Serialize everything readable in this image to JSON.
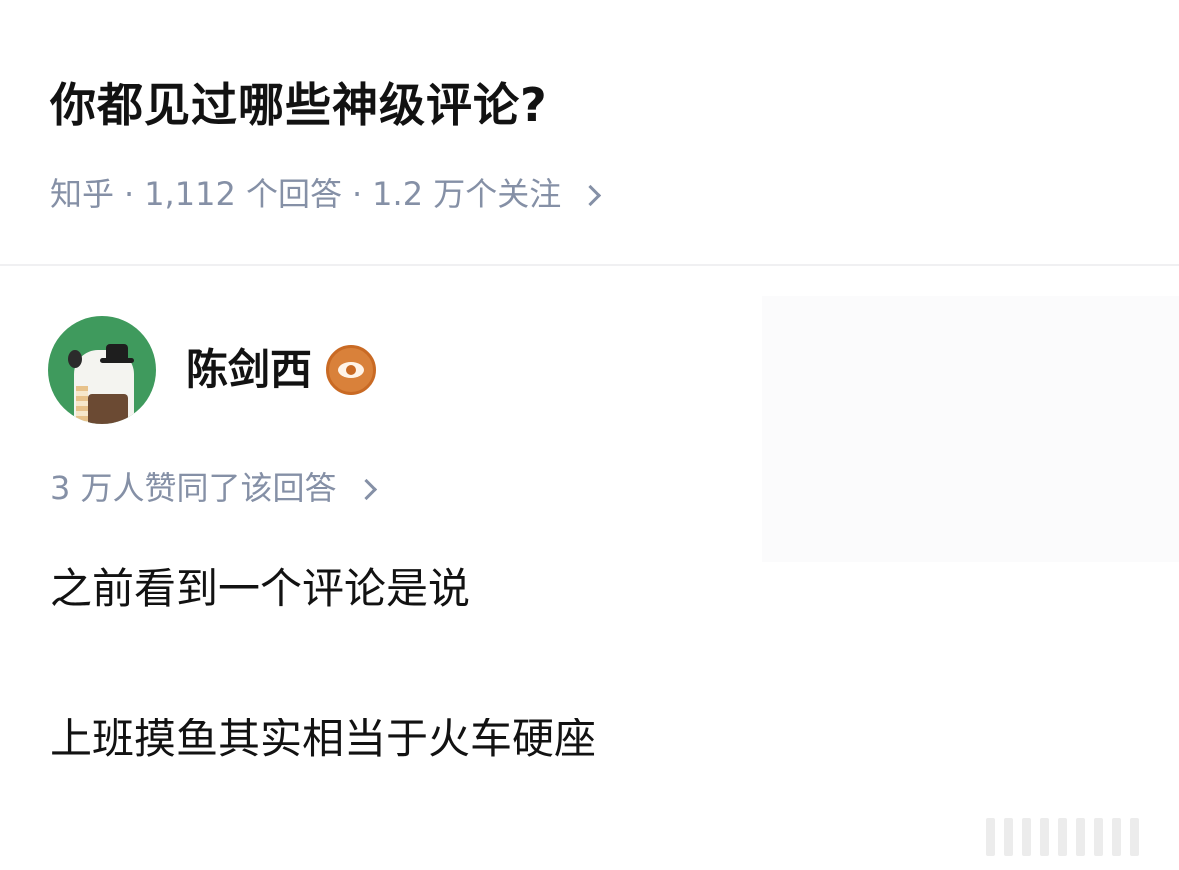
{
  "question": {
    "title": "你都见过哪些神级评论?",
    "source": "知乎",
    "separator": "·",
    "answers_count": "1,112 个回答",
    "followers_count": "1.2 万个关注"
  },
  "author": {
    "name": "陈剑西",
    "badge_icon": "eye-badge-icon"
  },
  "answer": {
    "votes_text": "3 万人赞同了该回答",
    "lines": [
      "之前看到一个评论是说",
      "上班摸鱼其实相当于火车硬座"
    ]
  }
}
